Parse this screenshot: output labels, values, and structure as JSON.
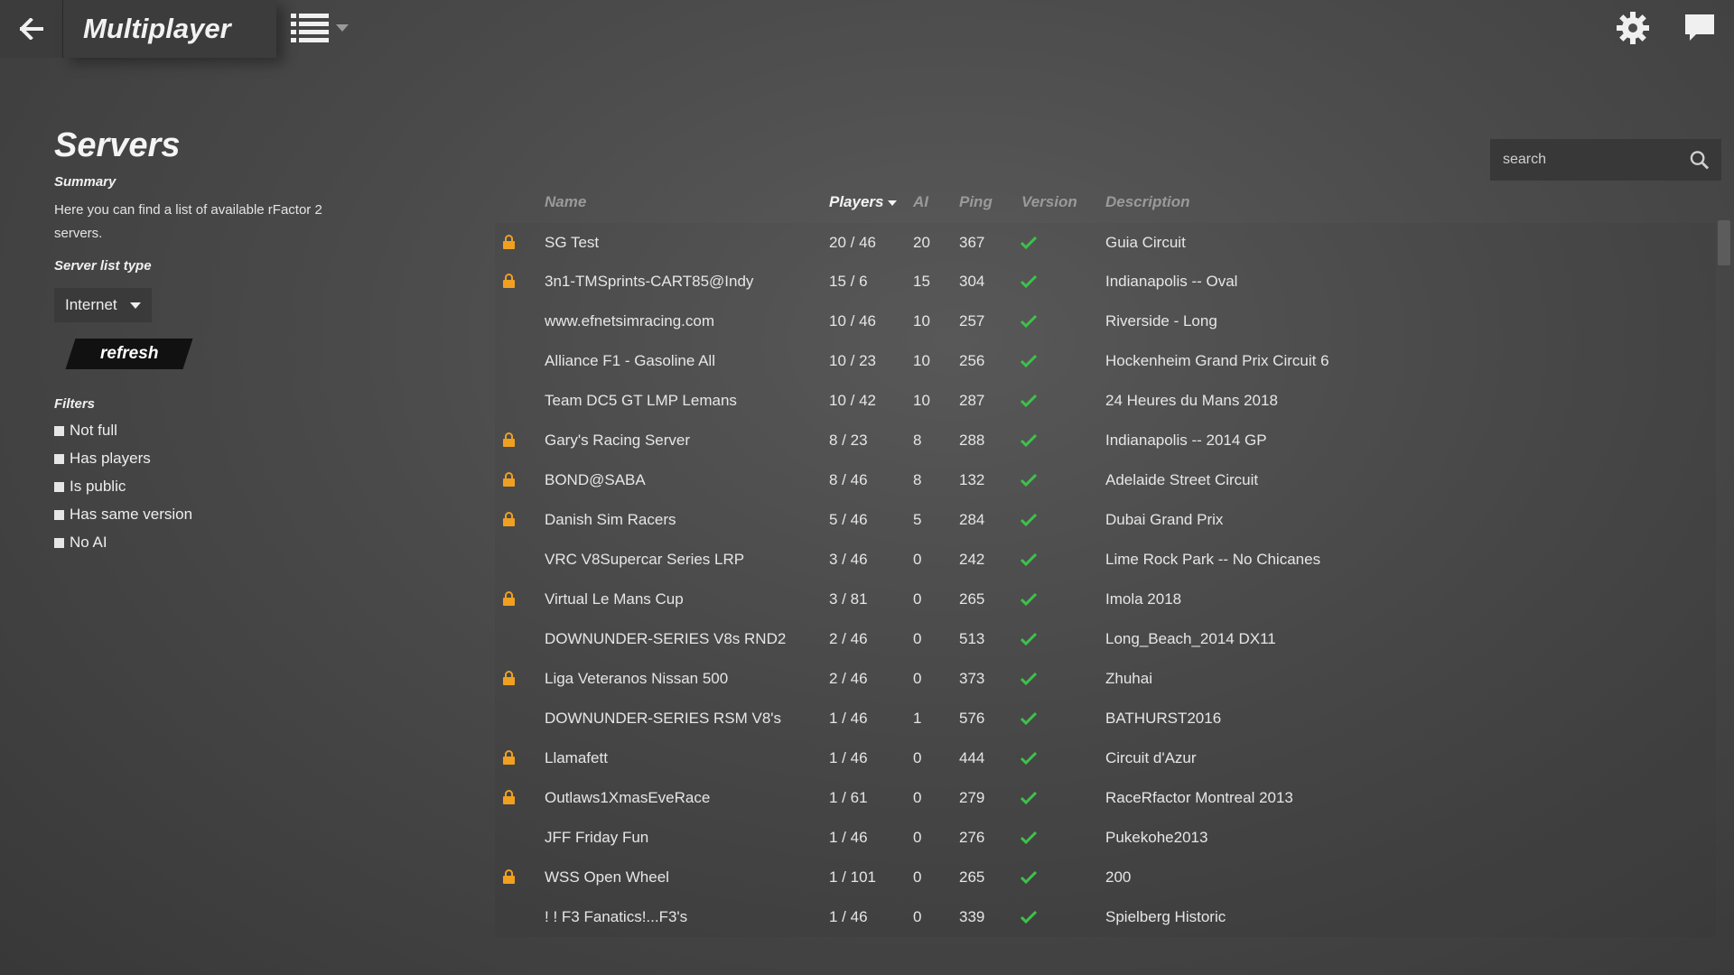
{
  "header": {
    "title": "Multiplayer"
  },
  "page": {
    "title": "Servers",
    "summary_heading": "Summary",
    "summary_text": "Here you can find a list of available rFactor 2 servers.",
    "server_list_type_heading": "Server list type",
    "server_list_type_value": "Internet",
    "refresh_label": "refresh",
    "filters_heading": "Filters",
    "filters": [
      {
        "label": "Not full"
      },
      {
        "label": "Has players"
      },
      {
        "label": "Is public"
      },
      {
        "label": "Has same version"
      },
      {
        "label": "No AI"
      }
    ]
  },
  "search": {
    "placeholder": "search"
  },
  "table": {
    "columns": {
      "name": "Name",
      "players": "Players",
      "ai": "AI",
      "ping": "Ping",
      "version": "Version",
      "description": "Description"
    },
    "sorted_column": "players",
    "rows": [
      {
        "locked": true,
        "name": "SG Test",
        "players": "20 / 46",
        "ai": "20",
        "ping": "367",
        "version_ok": true,
        "description": "Guia Circuit"
      },
      {
        "locked": true,
        "name": "3n1-TMSprints-CART85@Indy",
        "players": "15 / 6",
        "ai": "15",
        "ping": "304",
        "version_ok": true,
        "description": "Indianapolis -- Oval"
      },
      {
        "locked": false,
        "name": "www.efnetsimracing.com",
        "players": "10 / 46",
        "ai": "10",
        "ping": "257",
        "version_ok": true,
        "description": "Riverside - Long"
      },
      {
        "locked": false,
        "name": "Alliance F1 - Gasoline All",
        "players": "10 / 23",
        "ai": "10",
        "ping": "256",
        "version_ok": true,
        "description": "Hockenheim Grand Prix Circuit 6"
      },
      {
        "locked": false,
        "name": "Team DC5 GT LMP Lemans",
        "players": "10 / 42",
        "ai": "10",
        "ping": "287",
        "version_ok": true,
        "description": "24 Heures du Mans 2018"
      },
      {
        "locked": true,
        "name": "Gary's Racing Server",
        "players": "8 / 23",
        "ai": "8",
        "ping": "288",
        "version_ok": true,
        "description": "Indianapolis -- 2014 GP"
      },
      {
        "locked": true,
        "name": "BOND@SABA",
        "players": "8 / 46",
        "ai": "8",
        "ping": "132",
        "version_ok": true,
        "description": "Adelaide Street Circuit"
      },
      {
        "locked": true,
        "name": "Danish Sim Racers",
        "players": "5 / 46",
        "ai": "5",
        "ping": "284",
        "version_ok": true,
        "description": "Dubai Grand Prix"
      },
      {
        "locked": false,
        "name": "VRC V8Supercar Series LRP",
        "players": "3 / 46",
        "ai": "0",
        "ping": "242",
        "version_ok": true,
        "description": "Lime Rock Park -- No Chicanes"
      },
      {
        "locked": true,
        "name": "Virtual Le Mans Cup",
        "players": "3 / 81",
        "ai": "0",
        "ping": "265",
        "version_ok": true,
        "description": "Imola 2018"
      },
      {
        "locked": false,
        "name": "DOWNUNDER-SERIES V8s RND2",
        "players": "2 / 46",
        "ai": "0",
        "ping": "513",
        "version_ok": true,
        "description": "Long_Beach_2014 DX11"
      },
      {
        "locked": true,
        "name": "Liga Veteranos Nissan 500",
        "players": "2 / 46",
        "ai": "0",
        "ping": "373",
        "version_ok": true,
        "description": "Zhuhai"
      },
      {
        "locked": false,
        "name": "DOWNUNDER-SERIES RSM V8's",
        "players": "1 / 46",
        "ai": "1",
        "ping": "576",
        "version_ok": true,
        "description": "BATHURST2016"
      },
      {
        "locked": true,
        "name": "Llamafett",
        "players": "1 / 46",
        "ai": "0",
        "ping": "444",
        "version_ok": true,
        "description": "Circuit d'Azur"
      },
      {
        "locked": true,
        "name": "Outlaws1XmasEveRace",
        "players": "1 / 61",
        "ai": "0",
        "ping": "279",
        "version_ok": true,
        "description": "RaceRfactor Montreal 2013"
      },
      {
        "locked": false,
        "name": "JFF Friday Fun",
        "players": "1 / 46",
        "ai": "0",
        "ping": "276",
        "version_ok": true,
        "description": "Pukekohe2013"
      },
      {
        "locked": true,
        "name": "WSS Open Wheel",
        "players": "1 / 101",
        "ai": "0",
        "ping": "265",
        "version_ok": true,
        "description": "200"
      },
      {
        "locked": false,
        "name": "! ! F3 Fanatics!...F3's",
        "players": "1 / 46",
        "ai": "0",
        "ping": "339",
        "version_ok": true,
        "description": "Spielberg Historic"
      }
    ]
  },
  "colors": {
    "lock": "#f0a020",
    "check": "#3cc24a",
    "header_dim": "#9a9a9a"
  },
  "icons": {
    "back": "back-arrow-icon",
    "list_view": "list-view-icon",
    "settings": "gear-icon",
    "chat": "chat-icon",
    "search": "search-icon",
    "lock": "lock-icon",
    "check": "check-icon",
    "dropdown": "caret-down-icon"
  }
}
